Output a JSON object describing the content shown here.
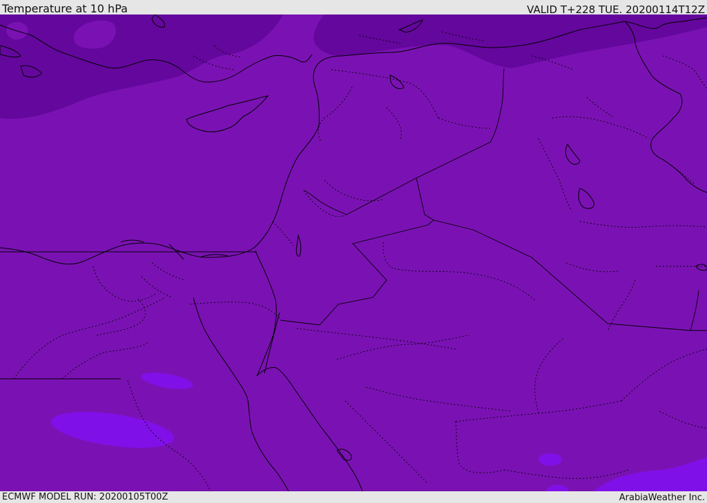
{
  "header": {
    "title": "Temperature at 10 hPa",
    "valid": "VALID T+228 TUE. 20200114T12Z"
  },
  "footer": {
    "model_run": "ECMWF MODEL RUN: 20200105T00Z",
    "credit": "ArabiaWeather Inc."
  },
  "colors": {
    "base_field": "#7a12b3",
    "cold_field": "#64079d",
    "warm_patch": "#8010e8",
    "line_color": "#000000"
  }
}
